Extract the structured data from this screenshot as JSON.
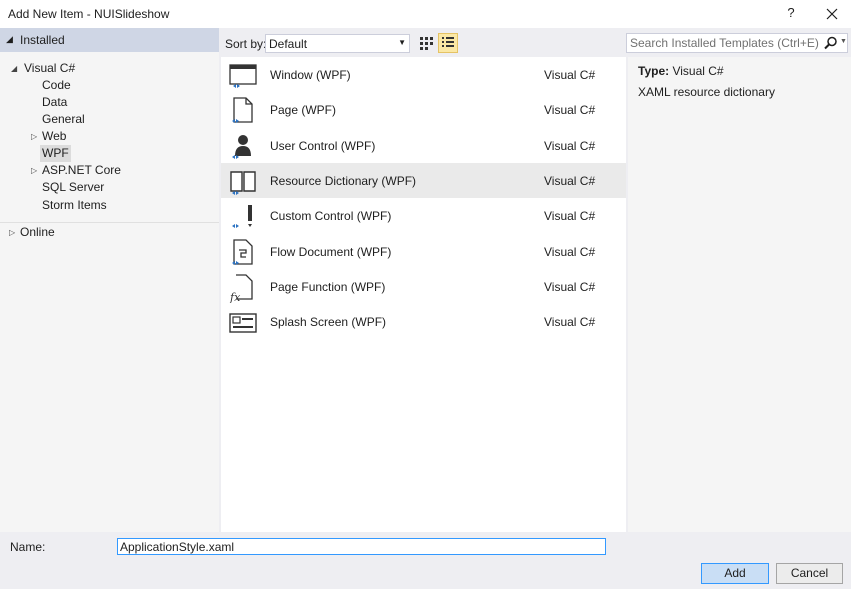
{
  "window": {
    "title": "Add New Item - NUISlideshow",
    "help_label": "?"
  },
  "tree": {
    "header": "Installed",
    "items": [
      {
        "label": "Visual C#"
      },
      {
        "label": "Code"
      },
      {
        "label": "Data"
      },
      {
        "label": "General"
      },
      {
        "label": "Web"
      },
      {
        "label": "WPF"
      },
      {
        "label": "ASP.NET Core"
      },
      {
        "label": "SQL Server"
      },
      {
        "label": "Storm Items"
      }
    ],
    "online": "Online",
    "selected": "WPF"
  },
  "toolbar": {
    "sort_label": "Sort by:",
    "sort_value": "Default",
    "view_mode": "list"
  },
  "search": {
    "placeholder": "Search Installed Templates (Ctrl+E)"
  },
  "templates": [
    {
      "name": "Window (WPF)",
      "lang": "Visual C#",
      "icon": "window-icon"
    },
    {
      "name": "Page (WPF)",
      "lang": "Visual C#",
      "icon": "page-icon"
    },
    {
      "name": "User Control (WPF)",
      "lang": "Visual C#",
      "icon": "user-control-icon"
    },
    {
      "name": "Resource Dictionary (WPF)",
      "lang": "Visual C#",
      "icon": "book-icon"
    },
    {
      "name": "Custom Control (WPF)",
      "lang": "Visual C#",
      "icon": "custom-control-icon"
    },
    {
      "name": "Flow Document (WPF)",
      "lang": "Visual C#",
      "icon": "flow-document-icon"
    },
    {
      "name": "Page Function (WPF)",
      "lang": "Visual C#",
      "icon": "page-function-icon"
    },
    {
      "name": "Splash Screen (WPF)",
      "lang": "Visual C#",
      "icon": "splash-screen-icon"
    }
  ],
  "selected_template": "Resource Dictionary (WPF)",
  "details": {
    "type_label": "Type:",
    "type_value": "Visual C#",
    "description": "XAML resource dictionary"
  },
  "bottom": {
    "name_label": "Name:",
    "name_value": "ApplicationStyle.xaml",
    "add_label": "Add",
    "cancel_label": "Cancel"
  },
  "colors": {
    "accent": "#3399ff",
    "icon_blue": "#2b72c2",
    "tree_header": "#cfd6e5",
    "view_active": "#fbe8a5"
  }
}
